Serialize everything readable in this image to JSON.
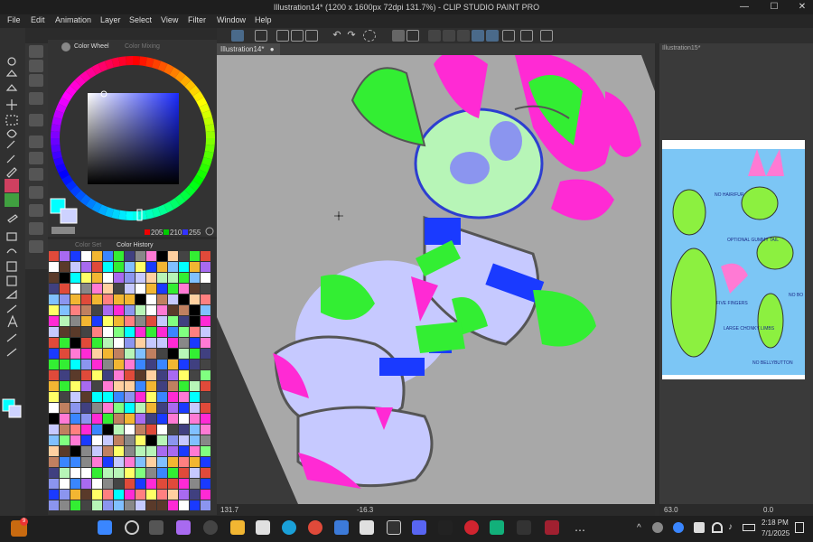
{
  "window": {
    "title": "Illustration14* (1200 x 1600px 72dpi 131.7%) - CLIP STUDIO PAINT PRO",
    "minimize": "—",
    "maximize": "☐",
    "close": "✕"
  },
  "menu": {
    "items": [
      "File",
      "Edit",
      "Animation",
      "Layer",
      "Select",
      "View",
      "Filter",
      "Window",
      "Help"
    ]
  },
  "color_panel": {
    "tab_active": "Color Wheel",
    "tab_inactive": "Color Mixing",
    "r": "205",
    "g": "210",
    "b": "255",
    "main_color": "#00ffff",
    "sub_color": "#cdd2ff"
  },
  "palette_panel": {
    "tab_inactive": "Color Set",
    "tab_active": "Color History"
  },
  "canvas": {
    "tab_label": "Illustration14*",
    "zoom": "131.7",
    "rotation": "-16.3",
    "bg_color": "#aaaaaa"
  },
  "right_panel": {
    "tab_label": "Illustration15*",
    "zoom": "63.0",
    "rotation": "0.0",
    "ref_labels": [
      "NO HAIR/FUR",
      "OPTIONAL GUMMY TAIL",
      "FIVE FINGERS",
      "LARGE CHONKY LIMBS",
      "NO BELLYBUTTON",
      "NO BO"
    ]
  },
  "taskbar": {
    "badge": "9",
    "time": "2:18 PM",
    "date": "7/1/2025"
  }
}
